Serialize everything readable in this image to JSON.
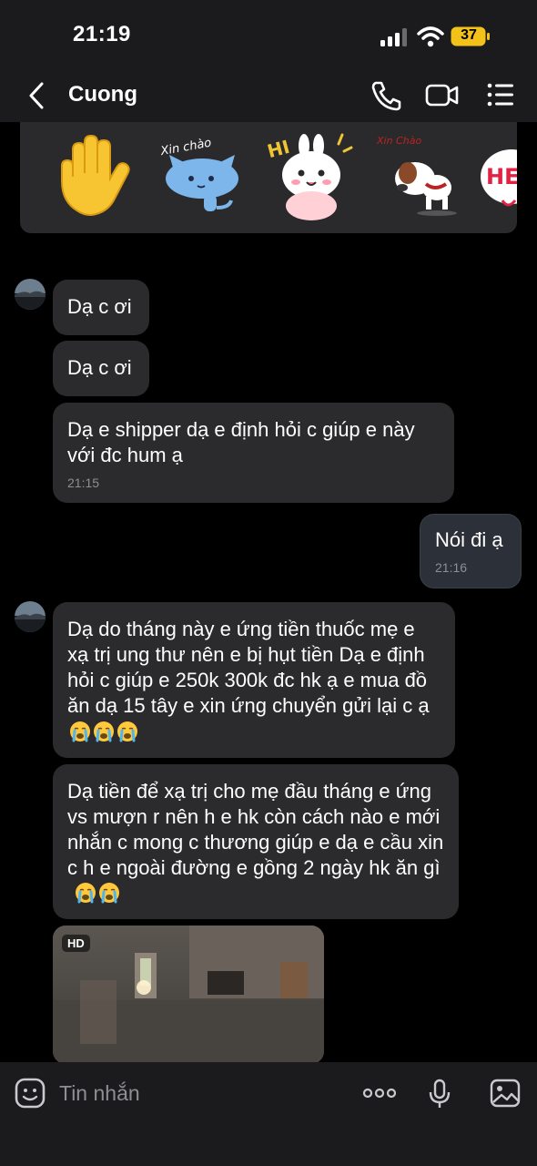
{
  "status_bar": {
    "time": "21:19",
    "battery": "37"
  },
  "header": {
    "contact_name": "Cuong",
    "back_icon": "chevron-left-icon",
    "call_icon": "phone-icon",
    "video_icon": "video-camera-icon",
    "menu_icon": "list-menu-icon"
  },
  "stickers": {
    "items": [
      {
        "icon": "waving-hand-sticker"
      },
      {
        "icon": "blue-cat-sticker",
        "text": "Xin chào"
      },
      {
        "icon": "bunny-sticker",
        "text": "HI"
      },
      {
        "icon": "dog-sticker",
        "text": "Xin Chào"
      },
      {
        "icon": "hello-sticker"
      }
    ]
  },
  "messages": [
    {
      "direction": "in",
      "text": "Dạ c ơi"
    },
    {
      "direction": "in",
      "text": "Dạ c ơi"
    },
    {
      "direction": "in",
      "text": "Dạ e shipper dạ e định hỏi c giúp e này với đc hum ạ",
      "time": "21:15"
    },
    {
      "direction": "out",
      "text": "Nói đi ạ",
      "time": "21:16"
    },
    {
      "direction": "in",
      "text": "Dạ do tháng này e ứng tiền thuốc mẹ e xạ trị ung thư nên e bị hụt tiền Dạ e định hỏi c giúp e 250k 300k đc hk ạ e mua đồ ăn dạ 15 tây e xin ứng chuyển gửi lại c ạ",
      "emoji": "😭😭😭"
    },
    {
      "direction": "in",
      "text": "Dạ tiền để xạ trị cho mẹ đầu tháng e ứng vs mượn r nên h e hk còn cách nào e mới nhắn c mong c thương giúp e dạ e cầu xin c h e ngoài đường e gồng 2 ngày hk ăn gì",
      "emoji": "😭😭"
    },
    {
      "direction": "in",
      "type": "video",
      "badge": "HD"
    }
  ],
  "composer": {
    "placeholder": "Tin nhắn",
    "sticker_icon": "sticker-face-icon",
    "more_icon": "more-dots-icon",
    "mic_icon": "microphone-icon",
    "image_icon": "image-icon"
  },
  "colors": {
    "background": "#000000",
    "bar": "#1b1b1d",
    "bubble_in": "#2b2b2d",
    "bubble_out": "#2c3038"
  }
}
